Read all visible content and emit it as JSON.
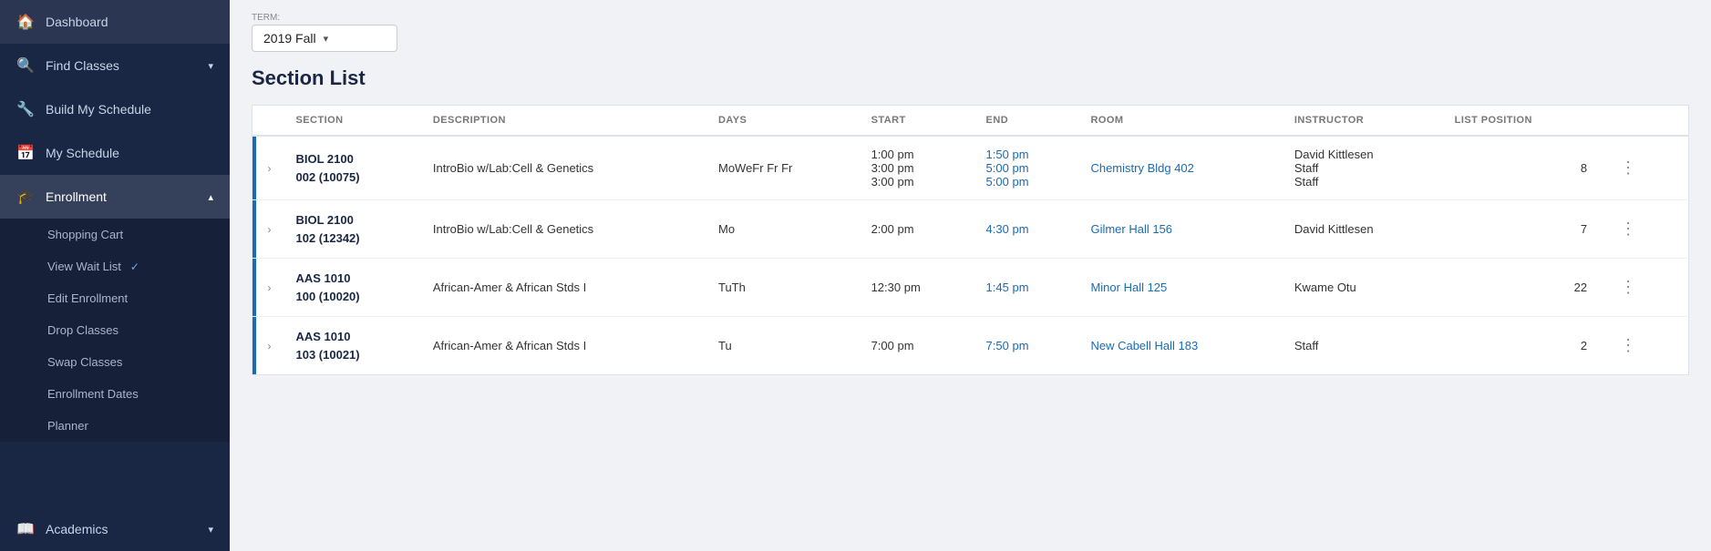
{
  "sidebar": {
    "items": [
      {
        "id": "dashboard",
        "label": "Dashboard",
        "icon": "🏠",
        "active": false
      },
      {
        "id": "find-classes",
        "label": "Find Classes",
        "icon": "🔍",
        "chevron": "▾",
        "active": false
      },
      {
        "id": "build-schedule",
        "label": "Build My Schedule",
        "icon": "🔧",
        "active": false
      },
      {
        "id": "my-schedule",
        "label": "My Schedule",
        "icon": "📅",
        "active": false
      },
      {
        "id": "enrollment",
        "label": "Enrollment",
        "icon": "🎓",
        "chevron": "▴",
        "active": true
      }
    ],
    "enrollment_sub": [
      {
        "id": "shopping-cart",
        "label": "Shopping Cart",
        "check": false
      },
      {
        "id": "view-wait-list",
        "label": "View Wait List",
        "check": true
      },
      {
        "id": "edit-enrollment",
        "label": "Edit Enrollment",
        "check": false
      },
      {
        "id": "drop-classes",
        "label": "Drop Classes",
        "check": false
      },
      {
        "id": "swap-classes",
        "label": "Swap Classes",
        "check": false
      },
      {
        "id": "enrollment-dates",
        "label": "Enrollment Dates",
        "check": false
      },
      {
        "id": "planner",
        "label": "Planner",
        "check": false
      }
    ],
    "bottom_items": [
      {
        "id": "academics",
        "label": "Academics",
        "icon": "📖",
        "chevron": "▾"
      }
    ]
  },
  "term": {
    "label": "Term:",
    "value": "2019 Fall"
  },
  "section_list": {
    "title": "Section List",
    "columns": [
      "SECTION",
      "DESCRIPTION",
      "DAYS",
      "START",
      "END",
      "ROOM",
      "INSTRUCTOR",
      "LIST POSITION"
    ],
    "rows": [
      {
        "id": "row1",
        "accent": true,
        "section": "BIOL 2100\n002 (10075)",
        "section_line1": "BIOL 2100",
        "section_line2": "002 (10075)",
        "description": "IntroBio w/Lab:Cell & Genetics",
        "days": "MoWeFr Fr Fr",
        "start_lines": [
          "1:00 pm",
          "3:00 pm",
          "3:00 pm"
        ],
        "end_lines": [
          "1:50 pm",
          "5:00 pm",
          "5:00 pm"
        ],
        "room": "Chemistry Bldg 402",
        "instructor_lines": [
          "David Kittlesen",
          "Staff",
          "Staff"
        ],
        "list_position": "8"
      },
      {
        "id": "row2",
        "accent": true,
        "section_line1": "BIOL 2100",
        "section_line2": "102 (12342)",
        "description": "IntroBio w/Lab:Cell & Genetics",
        "days": "Mo",
        "start_lines": [
          "2:00 pm"
        ],
        "end_lines": [
          "4:30 pm"
        ],
        "room": "Gilmer Hall 156",
        "instructor_lines": [
          "David Kittlesen"
        ],
        "list_position": "7"
      },
      {
        "id": "row3",
        "accent": true,
        "section_line1": "AAS 1010",
        "section_line2": "100 (10020)",
        "description": "African-Amer & African Stds I",
        "days": "TuTh",
        "start_lines": [
          "12:30 pm"
        ],
        "end_lines": [
          "1:45 pm"
        ],
        "room": "Minor Hall 125",
        "instructor_lines": [
          "Kwame Otu"
        ],
        "list_position": "22"
      },
      {
        "id": "row4",
        "accent": true,
        "section_line1": "AAS 1010",
        "section_line2": "103 (10021)",
        "description": "African-Amer & African Stds I",
        "days": "Tu",
        "start_lines": [
          "7:00 pm"
        ],
        "end_lines": [
          "7:50 pm"
        ],
        "room": "New Cabell Hall 183",
        "instructor_lines": [
          "Staff"
        ],
        "list_position": "2"
      }
    ]
  }
}
